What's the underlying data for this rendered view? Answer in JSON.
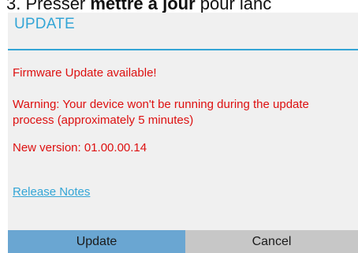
{
  "background_instruction": {
    "prefix": "3. Presser ",
    "bold": "mettre à jour",
    "suffix": " pour lanc"
  },
  "dialog": {
    "title": "UPDATE",
    "message_available": "Firmware Update available!",
    "message_warning": "Warning: Your device won't be running during the update process (approximately 5 minutes)",
    "message_version": "New version: 01.00.00.14",
    "release_notes_link": "Release Notes",
    "update_button": "Update",
    "cancel_button": "Cancel"
  },
  "colors": {
    "accent": "#33a5d6",
    "warning_text": "#dd1010",
    "update_button_bg": "#6aa6d2",
    "cancel_button_bg": "#c7c7c7",
    "dialog_bg": "#f0f0f0"
  }
}
